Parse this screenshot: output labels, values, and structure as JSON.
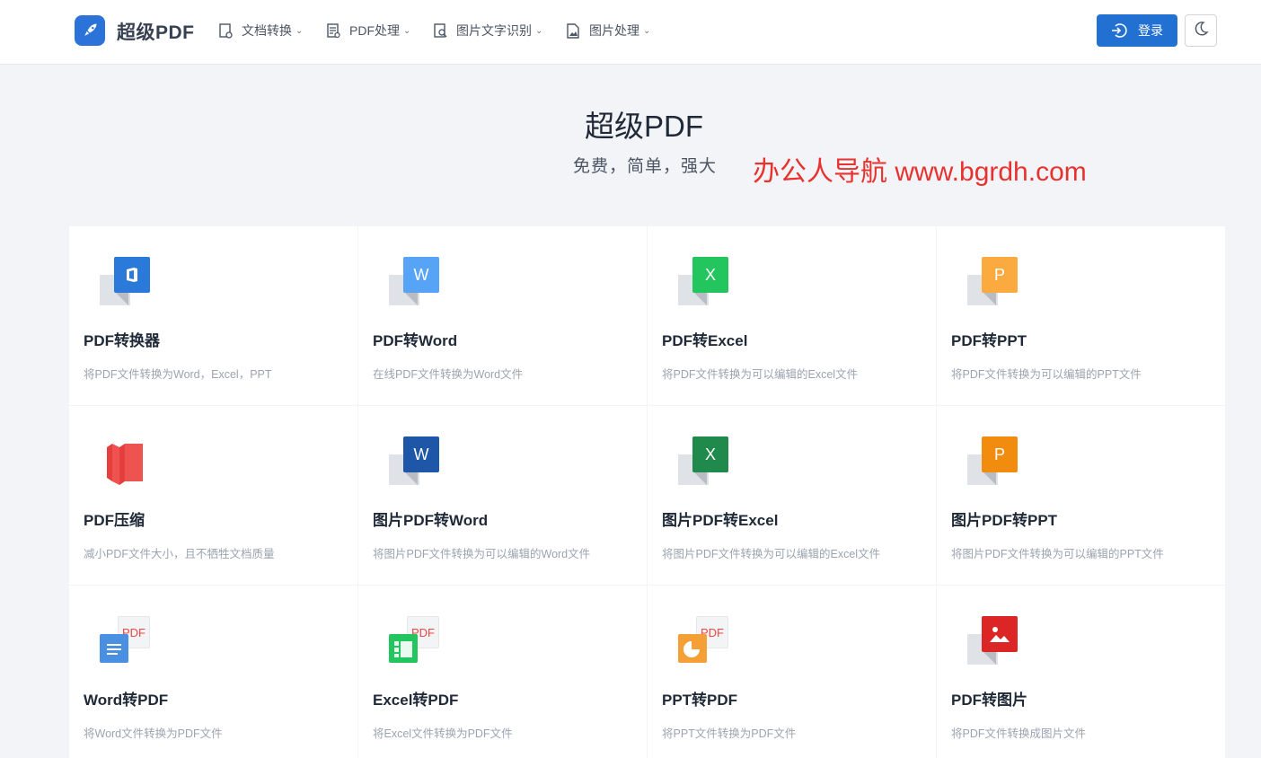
{
  "header": {
    "brand": "超级PDF",
    "nav": [
      {
        "label": "文档转换",
        "icon": "doc-convert-icon"
      },
      {
        "label": "PDF处理",
        "icon": "pdf-process-icon"
      },
      {
        "label": "图片文字识别",
        "icon": "ocr-icon"
      },
      {
        "label": "图片处理",
        "icon": "image-process-icon"
      }
    ],
    "login_label": "登录"
  },
  "hero": {
    "title": "超级PDF",
    "subtitle": "免费，简单，强大"
  },
  "watermark": "办公人导航 www.bgrdh.com",
  "cards": [
    {
      "title": "PDF转换器",
      "desc": "将PDF文件转换为Word，Excel，PPT",
      "icon": "office-icon",
      "color": "#2b7ad9",
      "letter": ""
    },
    {
      "title": "PDF转Word",
      "desc": "在线PDF文件转换为Word文件",
      "icon": "word-icon",
      "color": "#57a3f5",
      "letter": "W"
    },
    {
      "title": "PDF转Excel",
      "desc": "将PDF文件转换为可以编辑的Excel文件",
      "icon": "excel-icon",
      "color": "#22c55e",
      "letter": "X"
    },
    {
      "title": "PDF转PPT",
      "desc": "将PDF文件转换为可以编辑的PPT文件",
      "icon": "ppt-icon",
      "color": "#fbaa3f",
      "letter": "P"
    },
    {
      "title": "PDF压缩",
      "desc": "减小PDF文件大小，且不牺牲文档质量",
      "icon": "compress-icon",
      "color": "#ef5350",
      "letter": ""
    },
    {
      "title": "图片PDF转Word",
      "desc": "将图片PDF文件转换为可以编辑的Word文件",
      "icon": "word-icon",
      "color": "#1e56a8",
      "letter": "W"
    },
    {
      "title": "图片PDF转Excel",
      "desc": "将图片PDF文件转换为可以编辑的Excel文件",
      "icon": "excel-icon",
      "color": "#1f8a4c",
      "letter": "X"
    },
    {
      "title": "图片PDF转PPT",
      "desc": "将图片PDF文件转换为可以编辑的PPT文件",
      "icon": "ppt-icon",
      "color": "#f28c0f",
      "letter": "P"
    },
    {
      "title": "Word转PDF",
      "desc": "将Word文件转换为PDF文件",
      "icon": "word-to-pdf-icon",
      "color": "#4a90e2",
      "letter": "PDF"
    },
    {
      "title": "Excel转PDF",
      "desc": "将Excel文件转换为PDF文件",
      "icon": "excel-to-pdf-icon",
      "color": "#22c55e",
      "letter": "PDF"
    },
    {
      "title": "PPT转PDF",
      "desc": "将PPT文件转换为PDF文件",
      "icon": "ppt-to-pdf-icon",
      "color": "#f5a036",
      "letter": "PDF"
    },
    {
      "title": "PDF转图片",
      "desc": "将PDF文件转换成图片文件",
      "icon": "image-icon",
      "color": "#dc2626",
      "letter": ""
    }
  ]
}
